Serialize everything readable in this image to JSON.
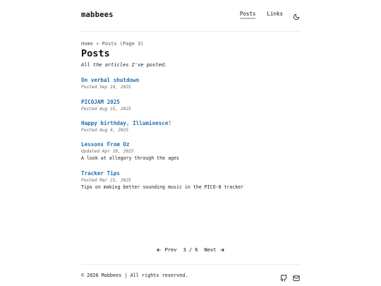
{
  "header": {
    "site_title": "mabbees",
    "nav": [
      {
        "label": "Posts",
        "active": true
      },
      {
        "label": "Links",
        "active": false
      }
    ],
    "theme_icon": "moon-icon"
  },
  "main": {
    "breadcrumb": {
      "home": "Home",
      "separator": "»",
      "current": "Posts (Page 3)"
    },
    "title": "Posts",
    "description": "All the articles I've posted.",
    "posts": [
      {
        "title": "On verbal shutdown",
        "meta": "Posted Sep 19, 2025",
        "summary": ""
      },
      {
        "title": "PICOJAM 2025",
        "meta": "Posted Aug 15, 2025",
        "summary": ""
      },
      {
        "title": "Happy birthday, Illuminesce!",
        "meta": "Posted Aug 4, 2025",
        "summary": ""
      },
      {
        "title": "Lessons From Oz",
        "meta": "Updated Apr 18, 2025",
        "summary": "A look at allegory through the ages"
      },
      {
        "title": "Tracker Tips",
        "meta": "Posted Mar 21, 2025",
        "summary": "Tips on making better sounding music in the PICO-8 tracker"
      }
    ]
  },
  "pagination": {
    "prev_label": "Prev",
    "page_status": "3 / 6",
    "next_label": "Next"
  },
  "footer": {
    "copyright": "© 2026 Mabbees | All rights reserved.",
    "icons": [
      "github-icon",
      "mail-icon"
    ]
  },
  "colors": {
    "link": "#1f6fb2",
    "text": "#111111",
    "muted": "#666666",
    "rule": "#ececec"
  }
}
